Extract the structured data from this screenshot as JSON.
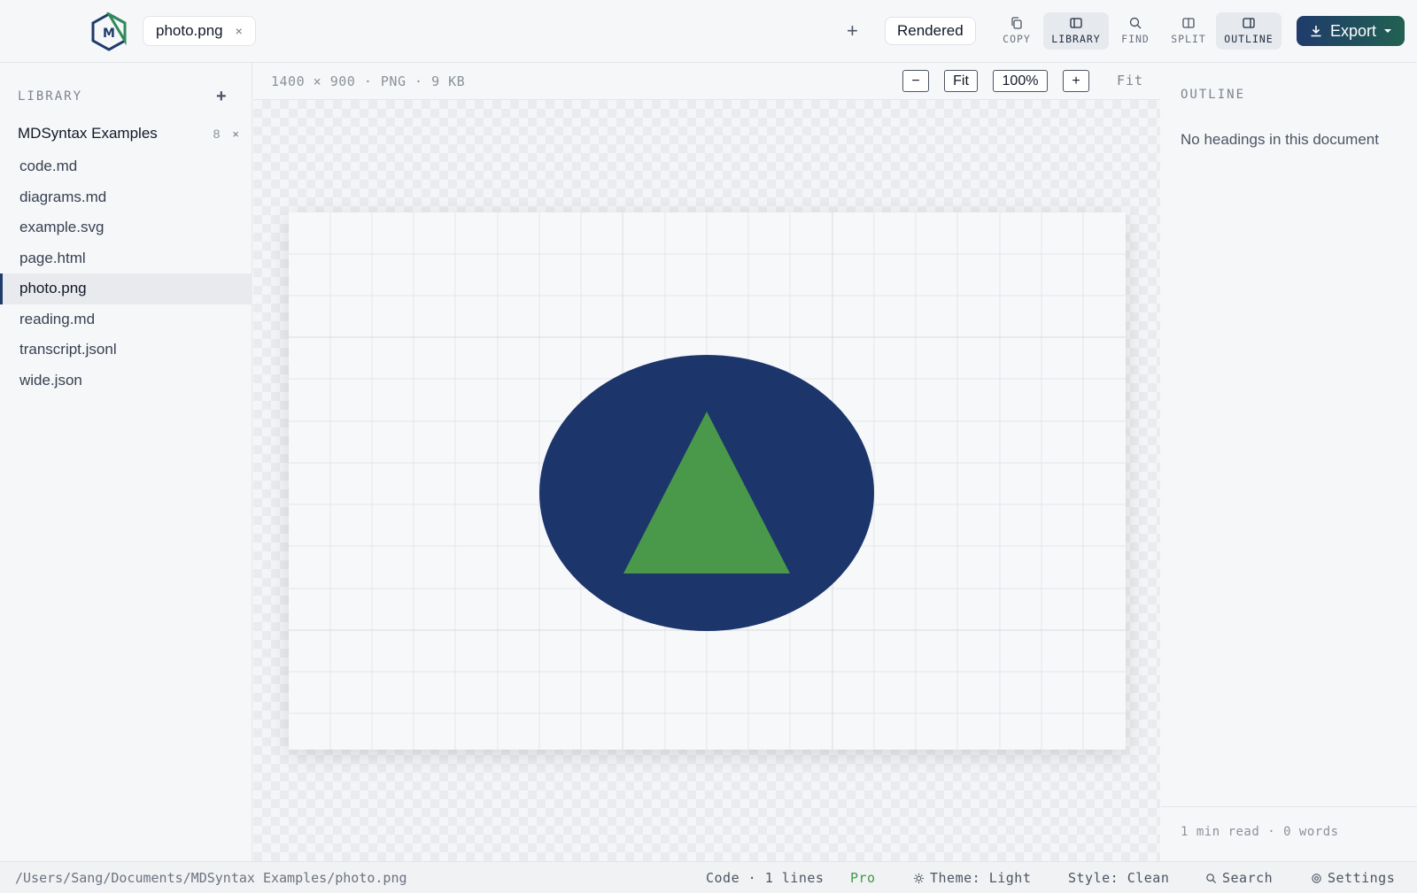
{
  "topbar": {
    "tab": {
      "label": "photo.png",
      "close": "×"
    },
    "new_tab": "+",
    "view_mode": "Rendered",
    "tools": {
      "copy": "COPY",
      "library": "LIBRARY",
      "find": "FIND",
      "split": "SPLIT",
      "outline": "OUTLINE"
    },
    "export": "Export"
  },
  "sidebar": {
    "heading": "LIBRARY",
    "add": "+",
    "group": {
      "name": "MDSyntax Examples",
      "count": "8",
      "close": "×"
    },
    "items": [
      {
        "label": "code.md"
      },
      {
        "label": "diagrams.md"
      },
      {
        "label": "example.svg"
      },
      {
        "label": "page.html"
      },
      {
        "label": "photo.png",
        "active": true
      },
      {
        "label": "reading.md"
      },
      {
        "label": "transcript.jsonl"
      },
      {
        "label": "wide.json"
      }
    ]
  },
  "viewer": {
    "meta": "1400 × 900 · PNG · 9 KB",
    "zoom_out": "−",
    "fit": "Fit",
    "zoom": "100%",
    "zoom_in": "+",
    "fit_label": "Fit"
  },
  "outline": {
    "heading": "OUTLINE",
    "empty": "No headings in this document",
    "footer": "1 min read · 0 words"
  },
  "status": {
    "path": "/Users/Sang/Documents/MDSyntax Examples/photo.png",
    "code": "Code · 1 lines",
    "pro": "Pro",
    "theme": "Theme: Light",
    "style": "Style: Clean",
    "search": "Search",
    "settings": "Settings"
  },
  "colors": {
    "accent_navy": "#1c356b",
    "accent_green": "#4a994a",
    "pro_green": "#3f9a46"
  }
}
